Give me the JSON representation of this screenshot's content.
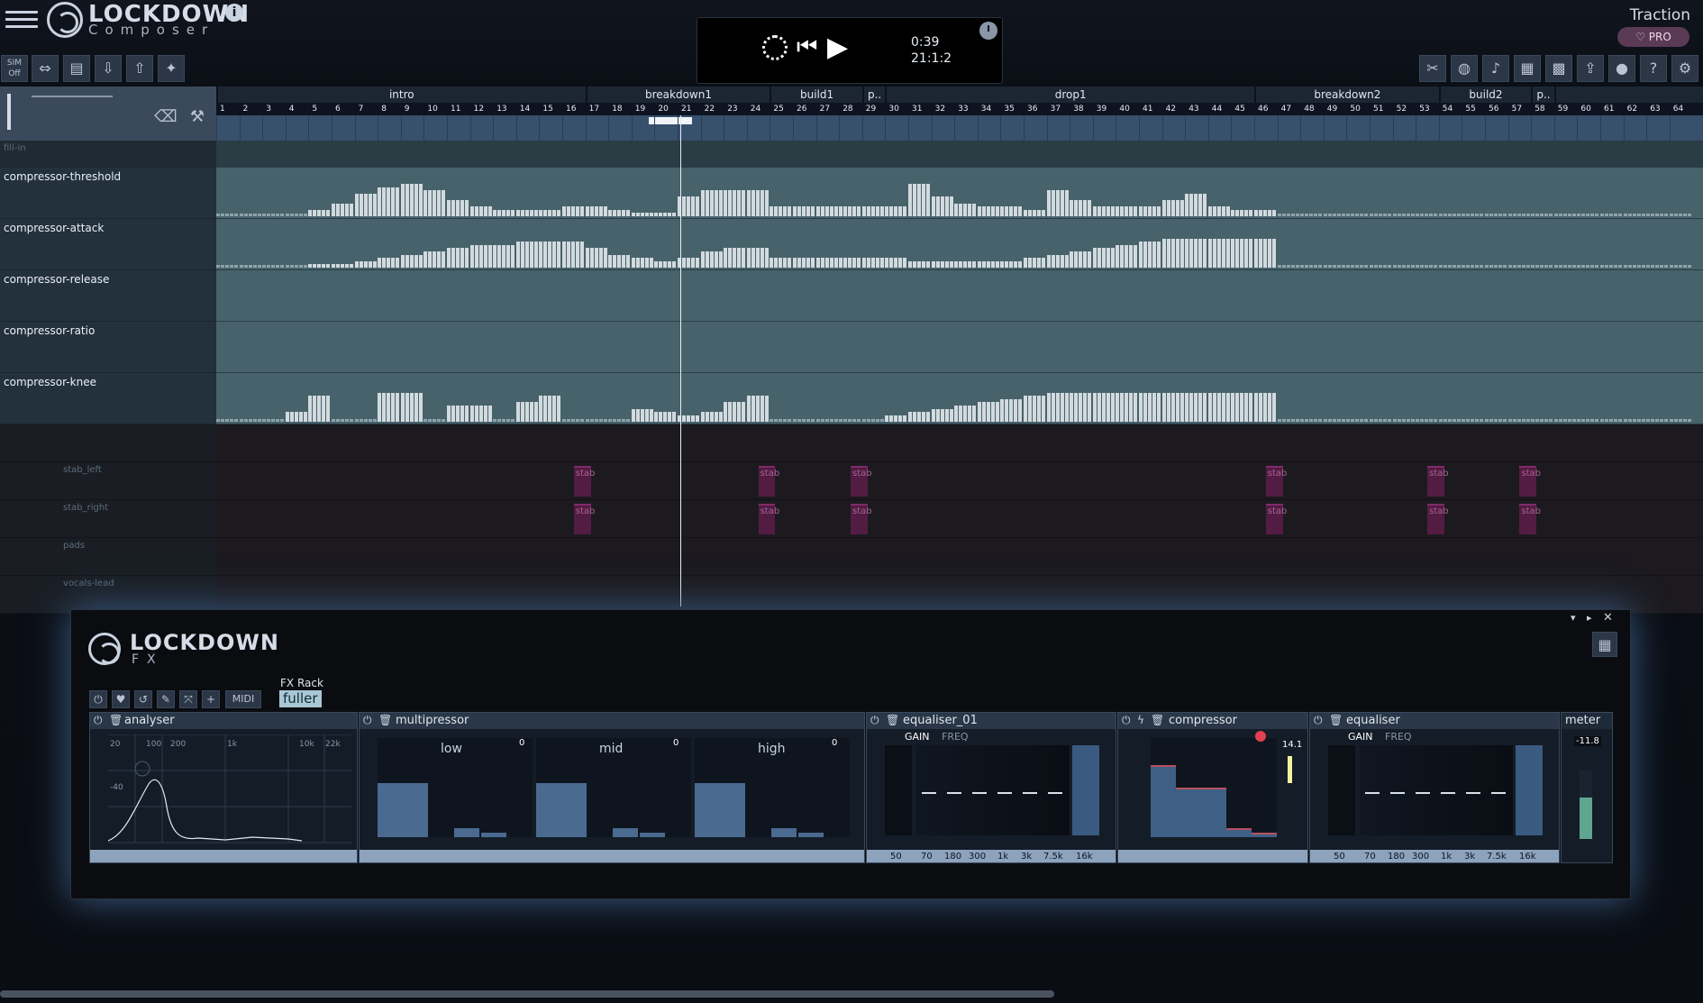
{
  "app": {
    "logo_title": "LOCKDOWN",
    "logo_sub": "Composer",
    "brand": "Traction",
    "pro_label": "♡ PRO",
    "sim_label": "SIM\nOff"
  },
  "transport": {
    "time": "0:39",
    "position": "21:1:2"
  },
  "sections": [
    {
      "label": "intro",
      "start": 1,
      "end": 16
    },
    {
      "label": "breakdown1",
      "start": 17,
      "end": 24
    },
    {
      "label": "build1",
      "start": 25,
      "end": 28
    },
    {
      "label": "p..",
      "start": 29,
      "end": 29
    },
    {
      "label": "drop1",
      "start": 30,
      "end": 45
    },
    {
      "label": "breakdown2",
      "start": 46,
      "end": 53
    },
    {
      "label": "build2",
      "start": 54,
      "end": 57
    },
    {
      "label": "p..",
      "start": 58,
      "end": 58
    }
  ],
  "bars": [
    "1",
    "2",
    "3",
    "4",
    "5",
    "6",
    "7",
    "8",
    "9",
    "10",
    "11",
    "12",
    "13",
    "14",
    "15",
    "16",
    "17",
    "18",
    "19",
    "20",
    "21",
    "22",
    "23",
    "24",
    "25",
    "26",
    "27",
    "28",
    "29",
    "30",
    "31",
    "32",
    "33",
    "34",
    "35",
    "36",
    "37",
    "38",
    "39",
    "40",
    "41",
    "42",
    "43",
    "44",
    "45",
    "46",
    "47",
    "48",
    "49",
    "50",
    "51",
    "52",
    "53",
    "54",
    "55",
    "56",
    "57",
    "58",
    "59",
    "60",
    "61",
    "62",
    "63",
    "64"
  ],
  "auto_tracks": [
    {
      "name": "fill-in"
    },
    {
      "name": "compressor-threshold"
    },
    {
      "name": "compressor-attack"
    },
    {
      "name": "compressor-release"
    },
    {
      "name": "compressor-ratio"
    },
    {
      "name": "compressor-knee"
    }
  ],
  "midi_tracks": [
    {
      "name": ""
    },
    {
      "name": "stab_left",
      "clip": "stab"
    },
    {
      "name": "stab_right",
      "clip": "stab"
    },
    {
      "name": "pads"
    },
    {
      "name": "vocals-lead"
    }
  ],
  "fx": {
    "logo_title": "LOCKDOWN",
    "logo_sub": "FX",
    "rack_label": "FX Rack",
    "rack_name": "fuller",
    "midi_label": "MIDI",
    "plugins": [
      {
        "name": "analyser"
      },
      {
        "name": "multipressor"
      },
      {
        "name": "equaliser_01"
      },
      {
        "name": "compressor"
      },
      {
        "name": "equaliser"
      },
      {
        "name": "meter"
      }
    ],
    "analyser_axis": [
      "20",
      "100",
      "200",
      "1k",
      "10k",
      "22k"
    ],
    "analyser_db": "-40",
    "multi_bands": [
      "low",
      "mid",
      "high"
    ],
    "multi_vals": [
      "0",
      "0",
      "0"
    ],
    "eq_gain_label": "GAIN",
    "eq_freq_label": "FREQ",
    "eq_freqs": [
      "50",
      "70",
      "180",
      "300",
      "1k",
      "3k",
      "7.5k",
      "16k"
    ],
    "comp_val": "14.1",
    "meter_val": "-11.8"
  }
}
